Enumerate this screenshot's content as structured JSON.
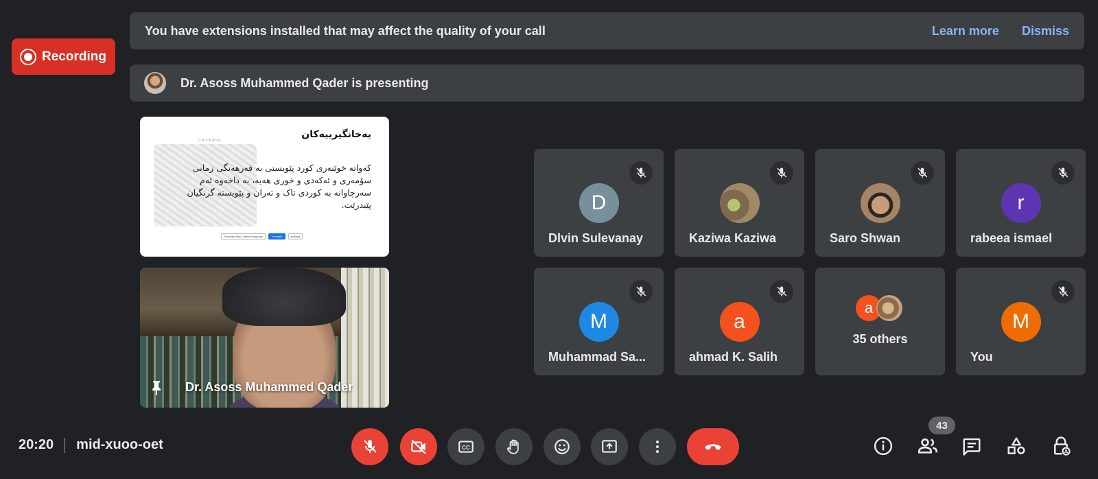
{
  "recording": {
    "label": "Recording"
  },
  "banners": {
    "extensions": {
      "message": "You have extensions installed that may affect the quality of your call",
      "learn_more": "Learn more",
      "dismiss": "Dismiss"
    },
    "presenting": {
      "message": "Dr. Asoss Muhammed Qader is presenting"
    }
  },
  "presentation": {
    "slide_title": "یەخانگیرییەکان",
    "slide_body": "کەواتە خوێنەری کورد پێویستی بە فەرهەنگی زمانی سۆمەری و ئەکەدی و خوری هەیە، بە داخەوە ئەم سەرچاوانە بە کوردی تاک و تەران و پێویستە گرنگیان پێبدرێت.",
    "slide_brand": "UNIVERSE",
    "slide_bar": [
      "Translate from: Detect language",
      "Translate",
      "settings"
    ]
  },
  "presenter_video": {
    "name": "Dr. Asoss Muhammed Qader"
  },
  "participants": [
    {
      "name": "Dlvin Sulevanay",
      "initial": "D",
      "color": "#78909c",
      "muted": true
    },
    {
      "name": "Kaziwa Kaziwa",
      "initial": "",
      "color": "#8d8a5c",
      "muted": true
    },
    {
      "name": "Saro Shwan",
      "initial": "",
      "color": "#a88466",
      "muted": true
    },
    {
      "name": "rabeea ismael",
      "initial": "r",
      "color": "#5e35b1",
      "muted": true
    },
    {
      "name": "Muhammad Sa...",
      "initial": "M",
      "color": "#1e88e5",
      "muted": true
    },
    {
      "name": "ahmad K. Salih",
      "initial": "a",
      "color": "#f4511e",
      "muted": true
    },
    {
      "name": "You",
      "initial": "M",
      "color": "#ef6c00",
      "muted": true
    }
  ],
  "others": {
    "label": "35 others",
    "avatar_initial": "a",
    "avatar_color": "#f4511e"
  },
  "footer": {
    "time": "20:20",
    "meeting_code": "mid-xuoo-oet",
    "controls": [
      "mic-off",
      "camera-off",
      "captions",
      "raise-hand",
      "emoji",
      "present",
      "more",
      "leave-call"
    ],
    "participant_count": "43"
  }
}
